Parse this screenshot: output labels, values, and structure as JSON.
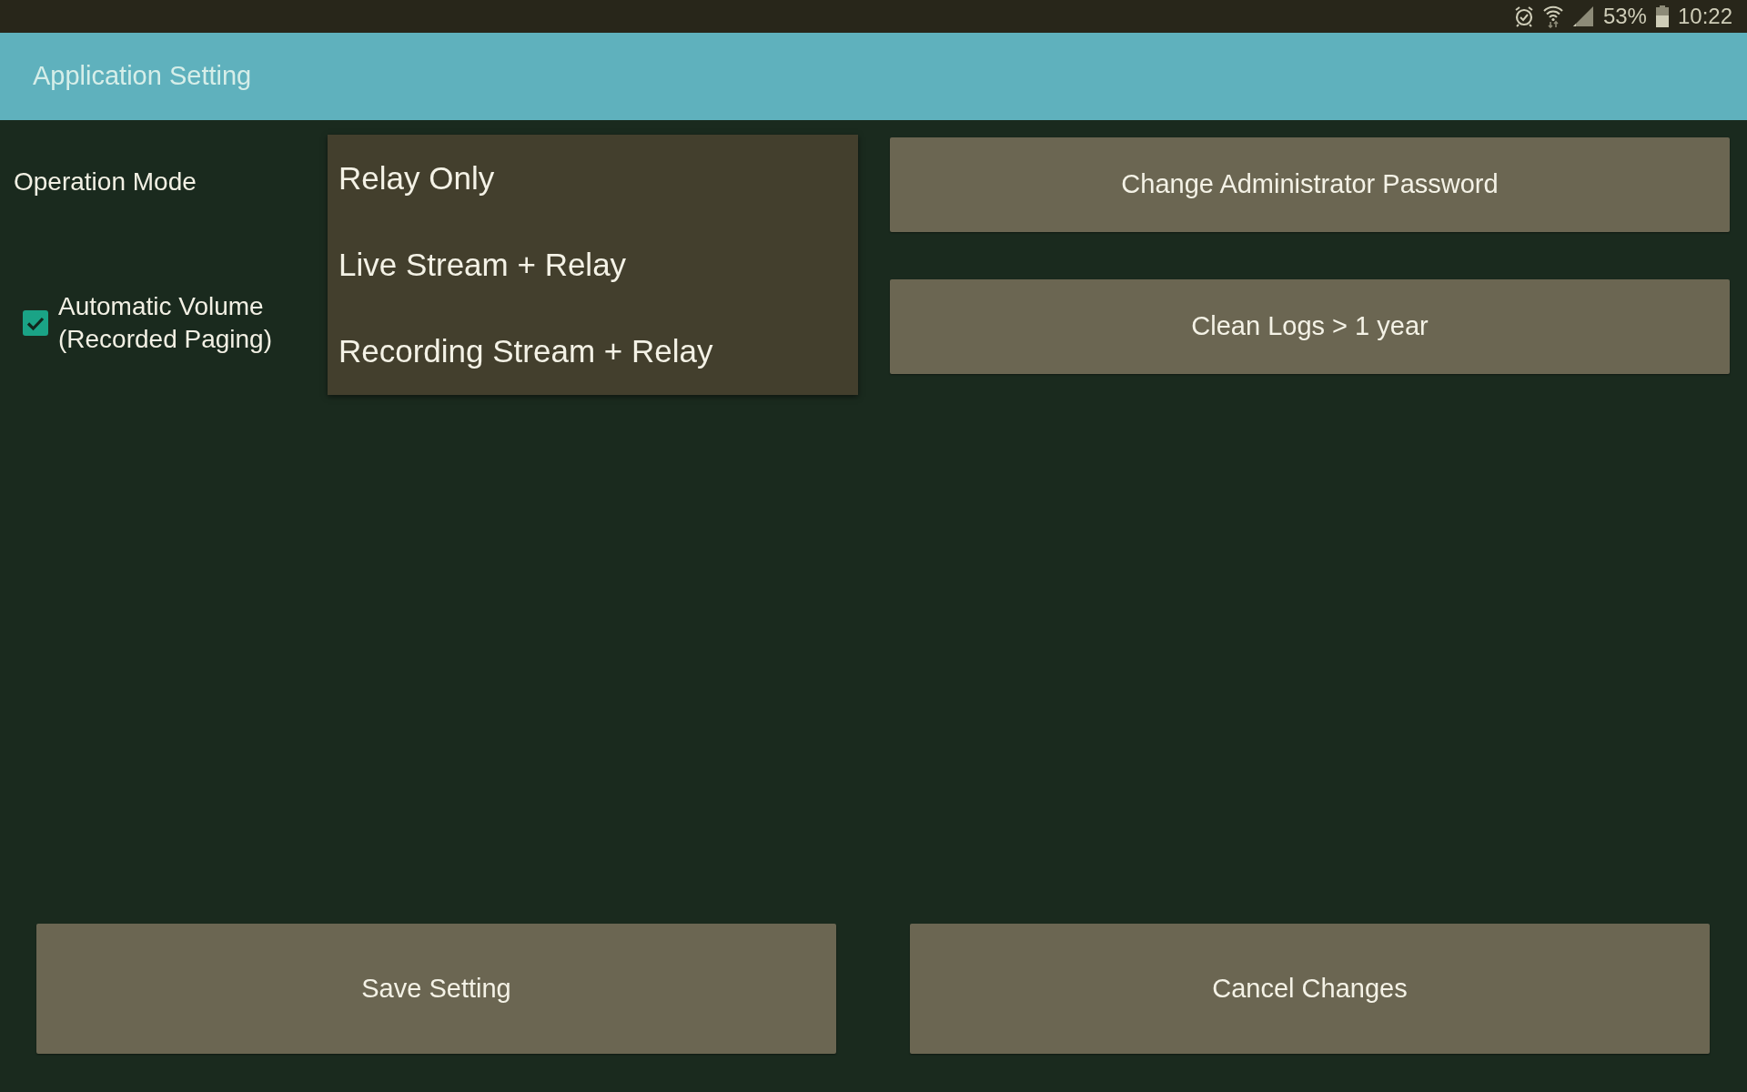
{
  "status_bar": {
    "battery_text": "53%",
    "time": "10:22"
  },
  "app_bar": {
    "title": "Application Setting"
  },
  "operation_mode": {
    "label": "Operation Mode",
    "options": [
      {
        "label": "Relay Only"
      },
      {
        "label": "Live Stream + Relay"
      },
      {
        "label": "Recording Stream + Relay"
      }
    ]
  },
  "auto_volume": {
    "label": "Automatic Volume (Recorded Paging)",
    "checked": true
  },
  "actions": [
    {
      "label": "Change Administrator Password"
    },
    {
      "label": "Clean Logs > 1 year"
    }
  ],
  "footer_buttons": [
    {
      "label": "Save Setting"
    },
    {
      "label": "Cancel Changes"
    }
  ]
}
